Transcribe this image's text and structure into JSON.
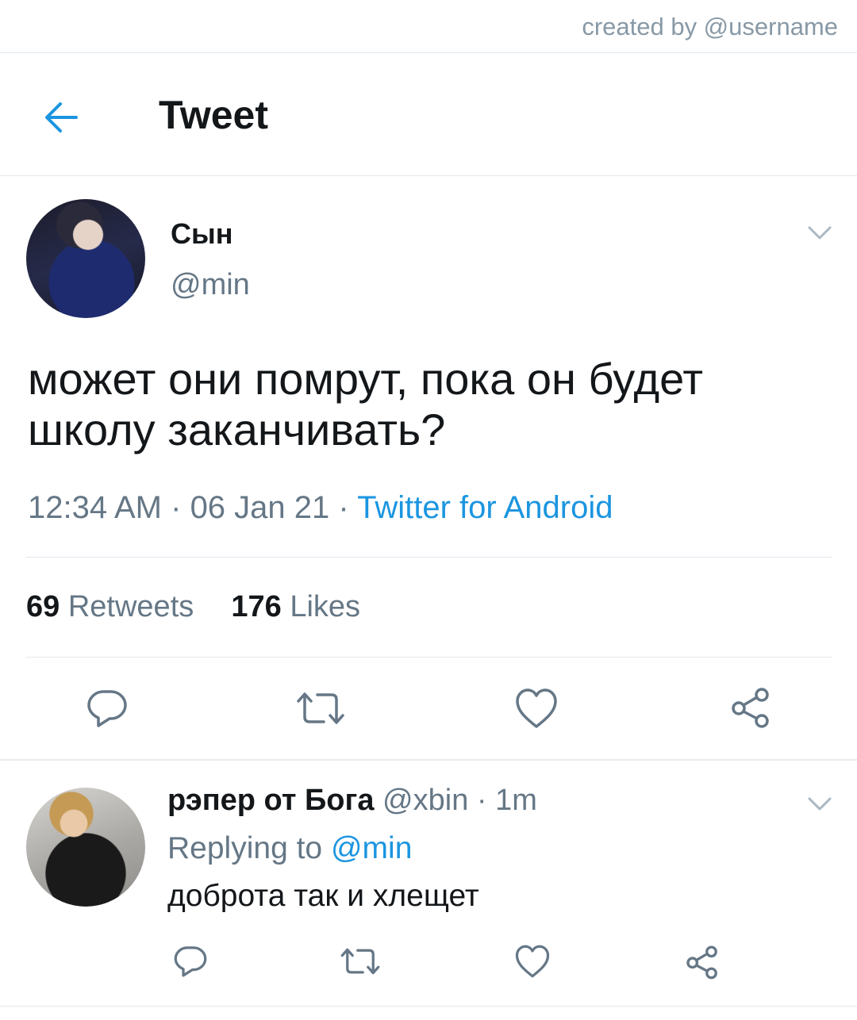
{
  "watermark": "created by @username",
  "header": {
    "back_icon": "arrow-left-icon",
    "title": "Tweet"
  },
  "tweet": {
    "author_name": "Сын",
    "author_handle": "@min",
    "text": "может они помрут, пока он будет\nшколу заканчивать?",
    "time": "12:34 AM",
    "sep1": " · ",
    "date": "06 Jan 21",
    "sep2": " · ",
    "source": "Twitter for Android",
    "retweets_count": "69",
    "retweets_label": "Retweets",
    "likes_count": "176",
    "likes_label": "Likes",
    "actions": [
      "reply-icon",
      "retweet-icon",
      "heart-icon",
      "share-icon"
    ]
  },
  "reply": {
    "author_name": "рэпер от Бога",
    "author_handle": "@xbin",
    "sep": " · ",
    "time_ago": "1m",
    "replying_label": "Replying to",
    "replying_to": "@min",
    "text": "доброта так и хлещет",
    "actions": [
      "reply-icon",
      "retweet-icon",
      "heart-icon",
      "share-icon"
    ]
  },
  "colors": {
    "link": "#1b95e0",
    "muted": "#657786",
    "text": "#14171a",
    "divider": "#e1e8ed"
  }
}
